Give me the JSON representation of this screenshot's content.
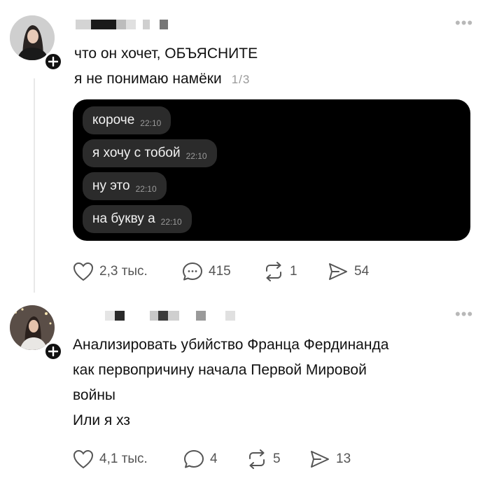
{
  "posts": [
    {
      "text_lines": [
        "что он хочет, ОБЪЯСНИТЕ",
        "я не понимаю намёки"
      ],
      "page_counter": "1/3",
      "messages": [
        {
          "text": "короче",
          "time": "22:10"
        },
        {
          "text": "я хочу с тобой",
          "time": "22:10"
        },
        {
          "text": "ну это",
          "time": "22:10"
        },
        {
          "text": "на букву а",
          "time": "22:10"
        }
      ],
      "actions": {
        "likes": "2,3 тыс.",
        "comments": "415",
        "reposts": "1",
        "shares": "54"
      }
    },
    {
      "text_lines": [
        "Анализировать убийство Франца Фердинанда",
        "как первопричину начала Первой Мировой",
        "войны",
        "Или я хз"
      ],
      "actions": {
        "likes": "4,1 тыс.",
        "comments": "4",
        "reposts": "5",
        "shares": "13"
      }
    }
  ],
  "icons": {
    "like": "heart-icon",
    "comment": "comment-icon",
    "repost": "repost-icon",
    "share": "share-icon",
    "follow": "plus-icon",
    "more": "more-icon"
  },
  "colors": {
    "text": "#111111",
    "muted": "#555555",
    "panel": "#000000",
    "bubble": "#2b2b2b"
  }
}
